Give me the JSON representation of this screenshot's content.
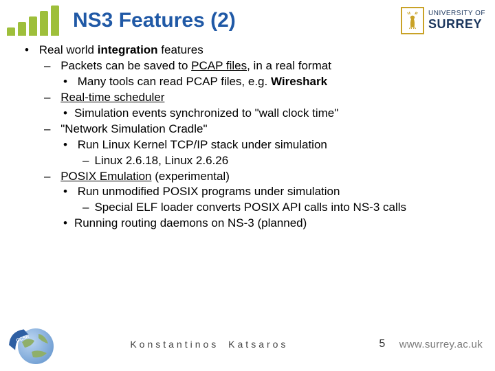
{
  "header": {
    "title": "NS3 Features (2)",
    "uni_line1": "UNIVERSITY OF",
    "uni_line2": "SURREY"
  },
  "bullets": {
    "root": "Real world ",
    "root_bold": "integration",
    "root_tail": " features",
    "pcap_a": "Packets can be saved to ",
    "pcap_u": "PCAP files",
    "pcap_b": ", in a real format",
    "pcap_sub_a": "Many tools can read PCAP files, e.g. ",
    "pcap_sub_b": "Wireshark",
    "rts": "Real-time scheduler",
    "rts_sub": "Simulation events synchronized to \"wall clock time\"",
    "nsc": "\"Network Simulation Cradle\"",
    "nsc_sub": "Run Linux Kernel TCP/IP stack under simulation",
    "nsc_sub2": "Linux 2.6.18, Linux 2.6.26",
    "posix": "POSIX Emulation",
    "posix_tail": " (experimental)",
    "posix_sub1": "Run unmodified POSIX programs under simulation",
    "posix_sub1a": "Special ELF loader converts POSIX API calls into NS-3 calls",
    "posix_sub2": "Running routing daemons on NS-3 (planned)"
  },
  "footer": {
    "author": "Konstantinos Katsaros",
    "page": "5",
    "url": "www.surrey.ac.uk",
    "ccsr": "CCSR"
  }
}
